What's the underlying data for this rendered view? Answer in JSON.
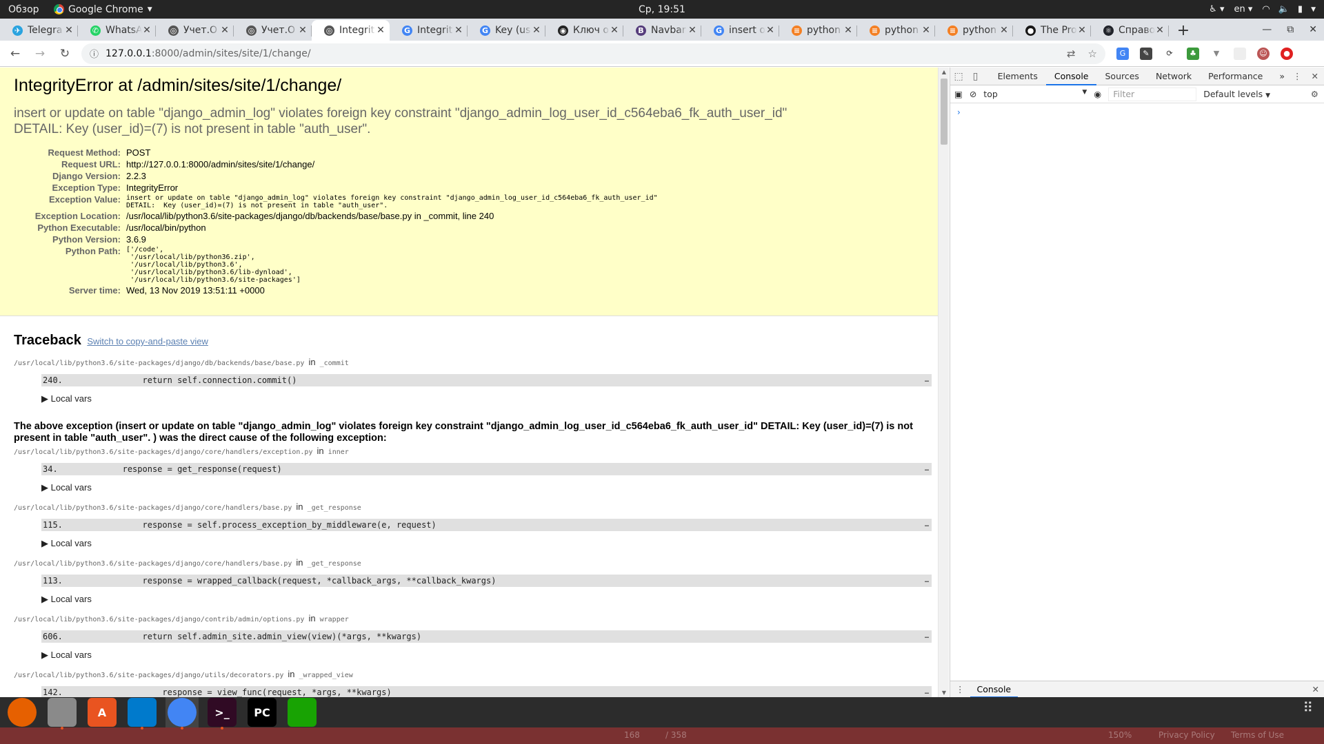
{
  "top_panel": {
    "activities": "Обзор",
    "app_name": "Google Chrome",
    "clock": "Ср, 19:51",
    "lang": "en"
  },
  "tabs": [
    {
      "title": "Telegra",
      "color": "#2aa3df",
      "glyph": "✈"
    },
    {
      "title": "WhatsA",
      "color": "#25d366",
      "glyph": "✆"
    },
    {
      "title": "Учет.О",
      "color": "#555555",
      "glyph": "◎"
    },
    {
      "title": "Учет.О",
      "color": "#555555",
      "glyph": "◎"
    },
    {
      "title": "Integrit",
      "color": "#555555",
      "glyph": "◎"
    },
    {
      "title": "Integrit",
      "color": "#4285f4",
      "glyph": "G"
    },
    {
      "title": "Key (us",
      "color": "#4285f4",
      "glyph": "G"
    },
    {
      "title": "Ключ о",
      "color": "#222222",
      "glyph": "◉"
    },
    {
      "title": "Navbar",
      "color": "#563d7c",
      "glyph": "B"
    },
    {
      "title": "insert o",
      "color": "#4285f4",
      "glyph": "G"
    },
    {
      "title": "python",
      "color": "#f48024",
      "glyph": "≡"
    },
    {
      "title": "python",
      "color": "#f48024",
      "glyph": "≡"
    },
    {
      "title": "python",
      "color": "#f48024",
      "glyph": "≡"
    },
    {
      "title": "The Pro",
      "color": "#181717",
      "glyph": "●"
    },
    {
      "title": "Справо",
      "color": "#20232a",
      "glyph": "⚛"
    }
  ],
  "address": {
    "host": "127.0.0.1",
    "path": ":8000/admin/sites/site/1/change/"
  },
  "error": {
    "title": "IntegrityError at /admin/sites/site/1/change/",
    "message": "insert or update on table \"django_admin_log\" violates foreign key constraint \"django_admin_log_user_id_c564eba6_fk_auth_user_id\"\nDETAIL:  Key (user_id)=(7) is not present in table \"auth_user\".",
    "meta": [
      {
        "label": "Request Method:",
        "value": "POST",
        "mono": false
      },
      {
        "label": "Request URL:",
        "value": "http://127.0.0.1:8000/admin/sites/site/1/change/",
        "mono": false
      },
      {
        "label": "Django Version:",
        "value": "2.2.3",
        "mono": false
      },
      {
        "label": "Exception Type:",
        "value": "IntegrityError",
        "mono": false
      },
      {
        "label": "Exception Value:",
        "value": "insert or update on table \"django_admin_log\" violates foreign key constraint \"django_admin_log_user_id_c564eba6_fk_auth_user_id\"\nDETAIL:  Key (user_id)=(7) is not present in table \"auth_user\".",
        "mono": true
      },
      {
        "label": "Exception Location:",
        "value": "/usr/local/lib/python3.6/site-packages/django/db/backends/base/base.py in _commit, line 240",
        "mono": false
      },
      {
        "label": "Python Executable:",
        "value": "/usr/local/bin/python",
        "mono": false
      },
      {
        "label": "Python Version:",
        "value": "3.6.9",
        "mono": false
      },
      {
        "label": "Python Path:",
        "value": "['/code',\n '/usr/local/lib/python36.zip',\n '/usr/local/lib/python3.6',\n '/usr/local/lib/python3.6/lib-dynload',\n '/usr/local/lib/python3.6/site-packages']",
        "mono": true
      },
      {
        "label": "Server time:",
        "value": "Wed, 13 Nov 2019 13:51:11 +0000",
        "mono": false
      }
    ]
  },
  "traceback": {
    "title": "Traceback",
    "copy_link": "Switch to copy-and-paste view",
    "local_vars": "▶ Local vars",
    "in_word": "in",
    "ellipsis": "…",
    "first_frame": {
      "file": "/usr/local/lib/python3.6/site-packages/django/db/backends/base/base.py",
      "func": "_commit",
      "code": "240.                return self.connection.commit()"
    },
    "cause": "The above exception (insert or update on table \"django_admin_log\" violates foreign key constraint \"django_admin_log_user_id_c564eba6_fk_auth_user_id\" DETAIL: Key (user_id)=(7) is not present in table \"auth_user\". ) was the direct cause of the following exception:",
    "frames": [
      {
        "file": "/usr/local/lib/python3.6/site-packages/django/core/handlers/exception.py",
        "func": "inner",
        "code": "34.             response = get_response(request)"
      },
      {
        "file": "/usr/local/lib/python3.6/site-packages/django/core/handlers/base.py",
        "func": "_get_response",
        "code": "115.                response = self.process_exception_by_middleware(e, request)"
      },
      {
        "file": "/usr/local/lib/python3.6/site-packages/django/core/handlers/base.py",
        "func": "_get_response",
        "code": "113.                response = wrapped_callback(request, *callback_args, **callback_kwargs)"
      },
      {
        "file": "/usr/local/lib/python3.6/site-packages/django/contrib/admin/options.py",
        "func": "wrapper",
        "code": "606.                return self.admin_site.admin_view(view)(*args, **kwargs)"
      },
      {
        "file": "/usr/local/lib/python3.6/site-packages/django/utils/decorators.py",
        "func": "_wrapped_view",
        "code": "142.                    response = view_func(request, *args, **kwargs)"
      }
    ]
  },
  "devtools": {
    "tabs": [
      "Elements",
      "Console",
      "Sources",
      "Network",
      "Performance"
    ],
    "active_tab": "Console",
    "more": "»",
    "context": "top",
    "filter_placeholder": "Filter",
    "levels": "Default levels",
    "prompt": "›",
    "drawer_tab": "Console"
  },
  "dock": {
    "apps": [
      {
        "name": "firefox",
        "label": "",
        "color": "#e66000",
        "running": false
      },
      {
        "name": "files",
        "label": "",
        "color": "#8a8a8a",
        "running": true
      },
      {
        "name": "software",
        "label": "A",
        "color": "#e95420",
        "running": false
      },
      {
        "name": "vscode",
        "label": "",
        "color": "#007acc",
        "running": true
      },
      {
        "name": "chrome",
        "label": "",
        "color": "#4285f4",
        "running": true
      },
      {
        "name": "terminal",
        "label": ">_",
        "color": "#300a24",
        "running": true
      },
      {
        "name": "pycharm",
        "label": "PC",
        "color": "#000000",
        "running": false
      },
      {
        "name": "spreadsheet",
        "label": "",
        "color": "#18a303",
        "running": false
      }
    ],
    "ghost_page": "168",
    "ghost_total": "/ 358",
    "ghost_zoom": "150%",
    "ghost_privacy": "Privacy Policy",
    "ghost_terms": "Terms of Use"
  }
}
